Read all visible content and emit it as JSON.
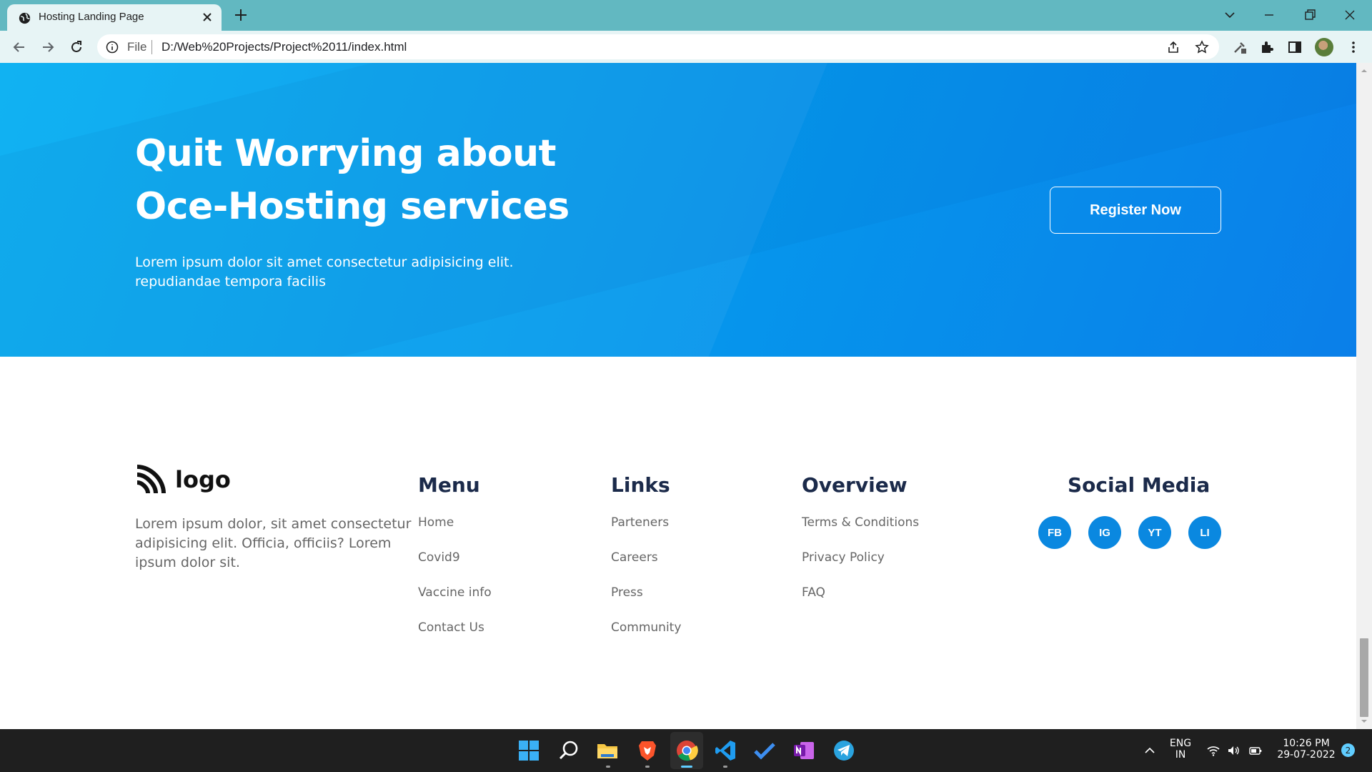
{
  "browser": {
    "tab_title": "Hosting Landing Page",
    "address_prefix": "File",
    "url": "D:/Web%20Projects/Project%2011/index.html"
  },
  "hero": {
    "heading_line1": "Quit Worrying about",
    "heading_line2": "Oce-Hosting services",
    "sub_line1": "Lorem ipsum dolor sit amet consectetur adipisicing elit.",
    "sub_line2": "repudiandae tempora facilis",
    "register_label": "Register Now"
  },
  "footer": {
    "logo_text": "logo",
    "description": "Lorem ipsum dolor, sit amet consectetur adipisicing elit. Officia, officiis? Lorem ipsum dolor sit.",
    "columns": [
      {
        "title": "Menu",
        "links": [
          "Home",
          "Covid9",
          "Vaccine info",
          "Contact Us"
        ]
      },
      {
        "title": "Links",
        "links": [
          "Parteners",
          "Careers",
          "Press",
          "Community"
        ]
      },
      {
        "title": "Overview",
        "links": [
          "Terms & Conditions",
          "Privacy Policy",
          "FAQ"
        ]
      }
    ],
    "social_title": "Social Media",
    "social": [
      "FB",
      "IG",
      "YT",
      "LI"
    ]
  },
  "taskbar": {
    "lang_line1": "ENG",
    "lang_line2": "IN",
    "time": "10:26 PM",
    "date": "29-07-2022",
    "notification_count": "2"
  },
  "colors": {
    "hero_start": "#05aef2",
    "hero_end": "#0a7fe9",
    "social_button": "#0a88e0",
    "footer_title": "#1b2a4a"
  }
}
